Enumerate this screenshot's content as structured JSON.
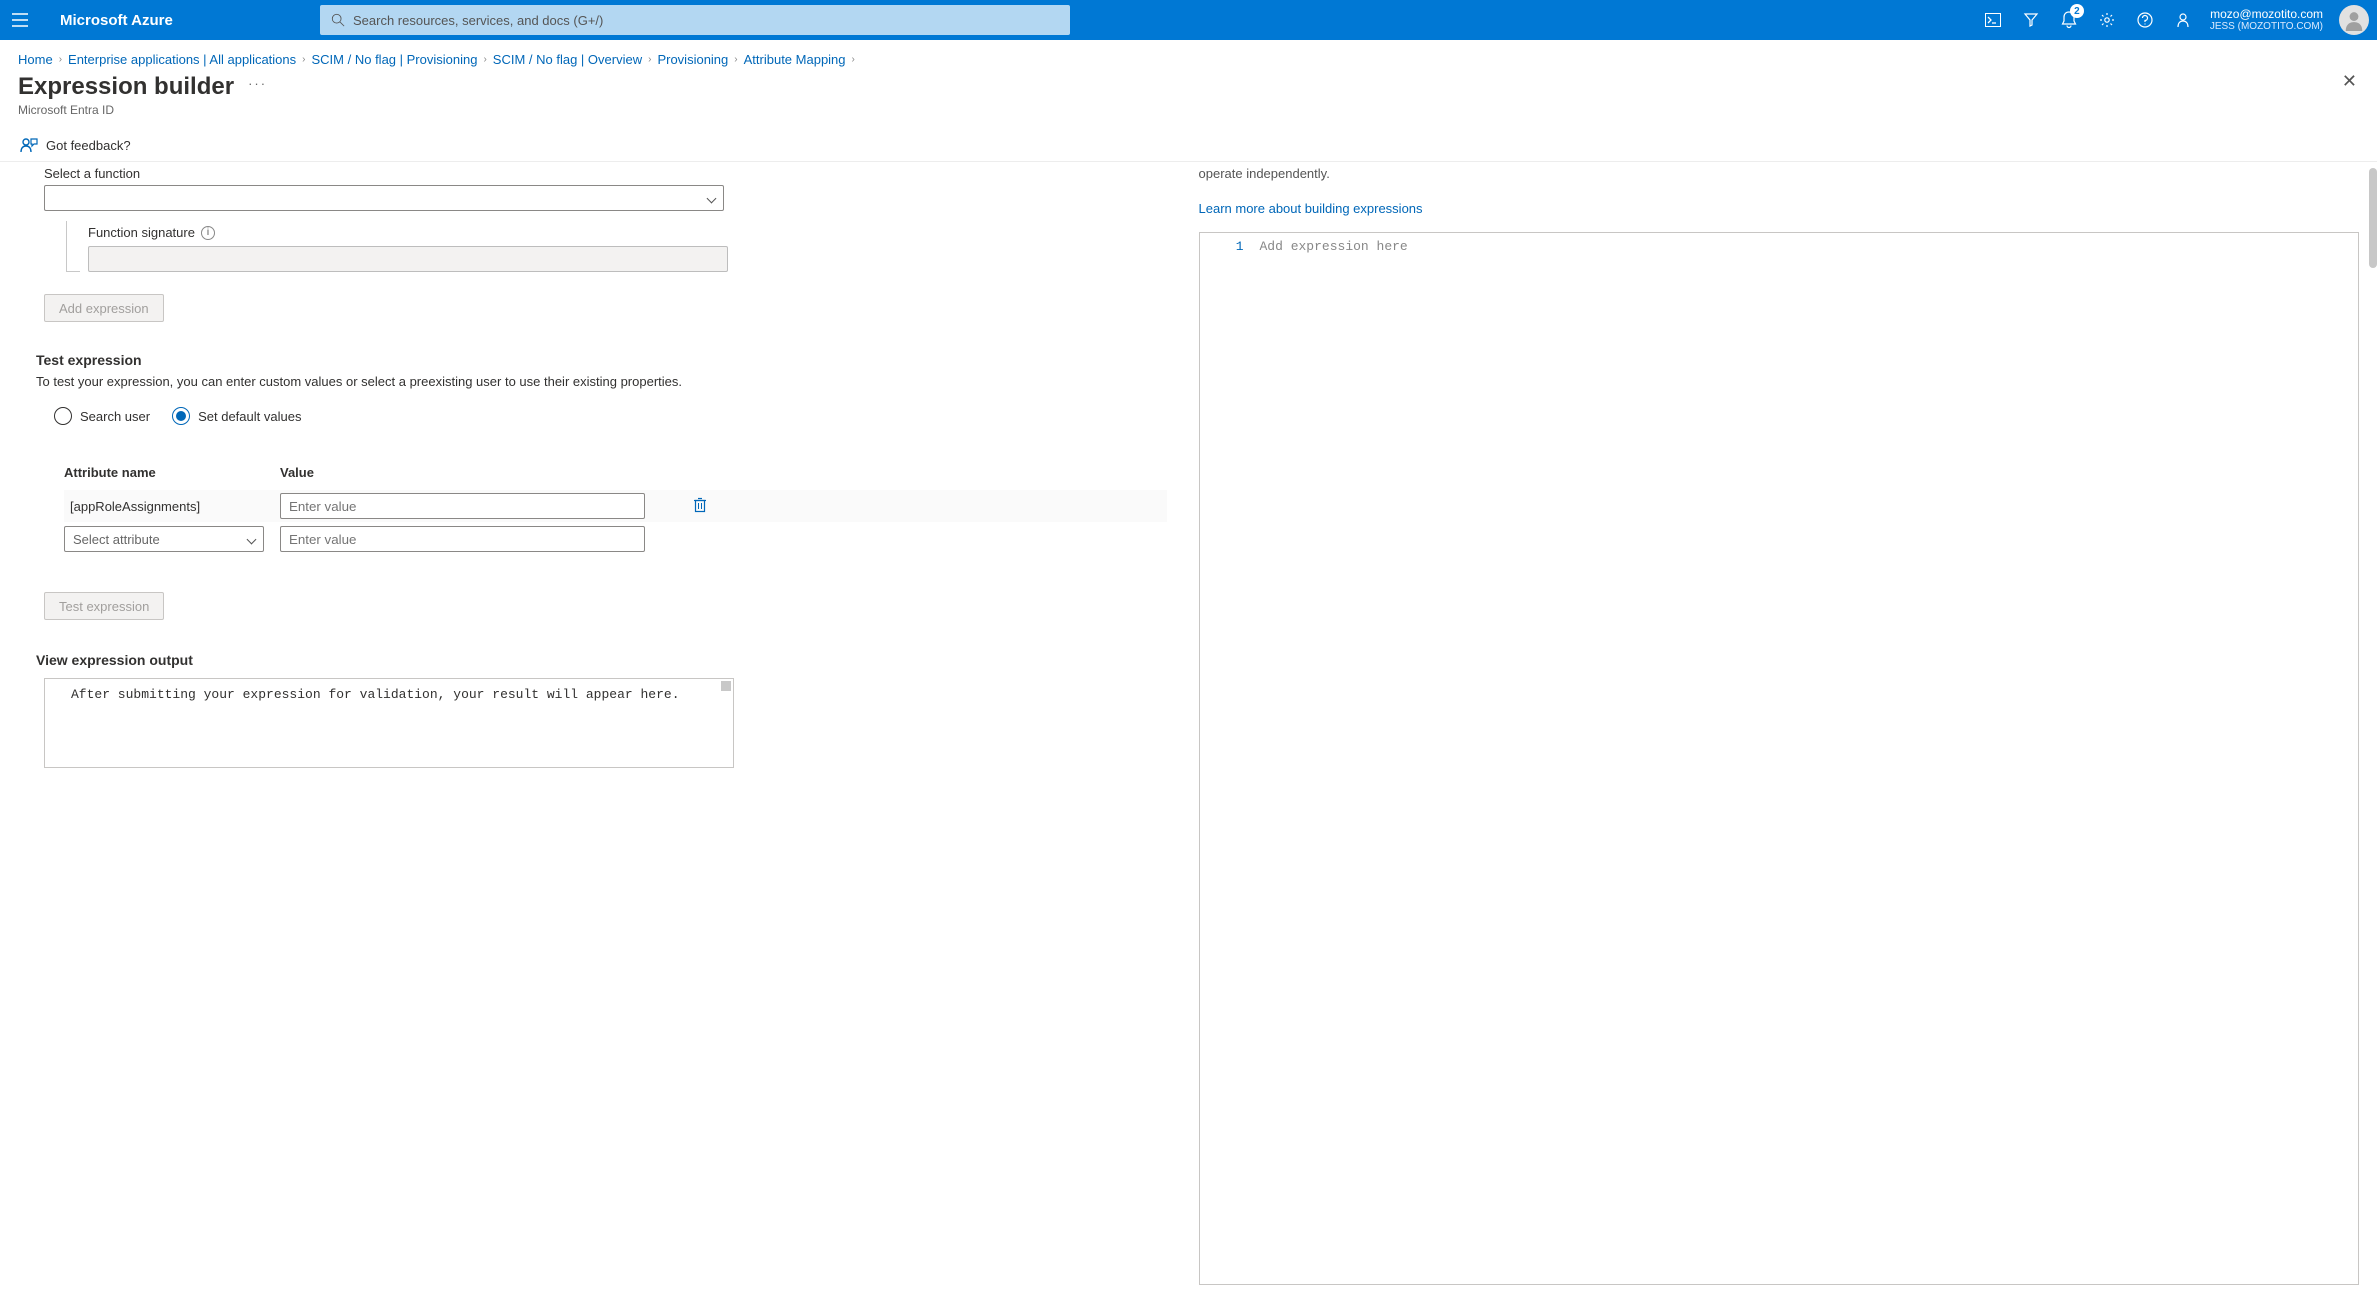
{
  "header": {
    "brand": "Microsoft Azure",
    "search_placeholder": "Search resources, services, and docs (G+/)",
    "notification_count": "2",
    "account_email": "mozo@mozotito.com",
    "account_org": "JESS (MOZOTITO.COM)"
  },
  "breadcrumbs": [
    "Home",
    "Enterprise applications | All applications",
    "SCIM / No flag | Provisioning",
    "SCIM / No flag | Overview",
    "Provisioning",
    "Attribute Mapping"
  ],
  "page": {
    "title": "Expression builder",
    "subtitle": "Microsoft Entra ID",
    "feedback": "Got feedback?"
  },
  "left": {
    "select_function_label": "Select a function",
    "sig_label": "Function signature",
    "add_expr_btn": "Add expression",
    "test_h": "Test expression",
    "test_p": "To test your expression, you can enter custom values or select a preexisting user to use their existing properties.",
    "radio_search": "Search user",
    "radio_default": "Set default values",
    "col_name": "Attribute name",
    "col_value": "Value",
    "row1_name": "[appRoleAssignments]",
    "value_placeholder": "Enter value",
    "select_attr_placeholder": "Select attribute",
    "test_btn": "Test expression",
    "out_h": "View expression output",
    "out_text": "After submitting your expression for validation, your result will appear here."
  },
  "right": {
    "trunc": "operate independently.",
    "learn": "Learn more about building expressions",
    "line_no": "1",
    "code_placeholder": "Add expression here"
  }
}
